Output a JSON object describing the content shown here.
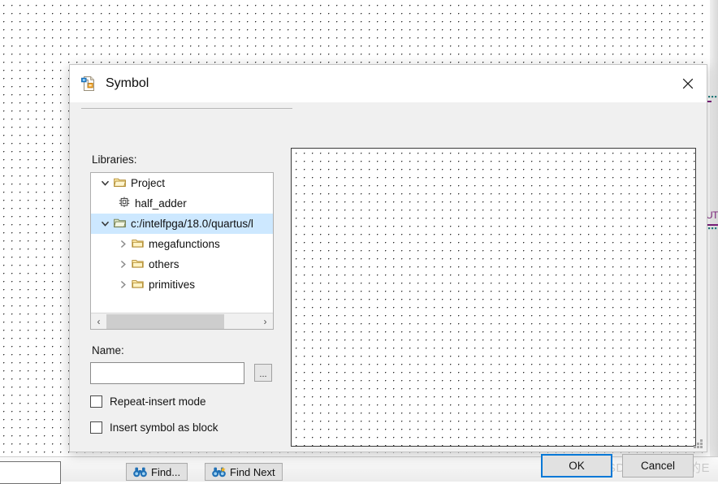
{
  "background": {
    "canvas_name": "schematic-grid-canvas",
    "schematic_fragment_label": "OUT",
    "grid_color": "#2b2b2b",
    "wire_color": "#7b1f7b"
  },
  "dialog": {
    "title": "Symbol",
    "title_icon": "symbol-file-icon",
    "close_icon": "close-icon",
    "libraries_label": "Libraries:",
    "name_label": "Name:",
    "name_value": "",
    "name_placeholder": "",
    "browse_label": "...",
    "tree": [
      {
        "label": "Project",
        "icon": "folder-open-icon",
        "twisty": "chevron-down-icon",
        "indent": 0,
        "selected": false
      },
      {
        "label": "half_adder",
        "icon": "symbol-block-icon",
        "twisty": "",
        "indent": 1,
        "selected": false
      },
      {
        "label": "c:/intelfpga/18.0/quartus/l",
        "icon": "folder-open-icon",
        "twisty": "chevron-down-icon",
        "indent": 0,
        "selected": true
      },
      {
        "label": "megafunctions",
        "icon": "folder-closed-icon",
        "twisty": "chevron-right-icon",
        "indent": 1,
        "selected": false
      },
      {
        "label": "others",
        "icon": "folder-closed-icon",
        "twisty": "chevron-right-icon",
        "indent": 1,
        "selected": false
      },
      {
        "label": "primitives",
        "icon": "folder-closed-icon",
        "twisty": "chevron-right-icon",
        "indent": 1,
        "selected": false
      }
    ],
    "scrollbar": {
      "left_arrow": "‹",
      "right_arrow": "›"
    },
    "checkboxes": [
      {
        "label": "Repeat-insert mode",
        "checked": false
      },
      {
        "label": "Insert symbol as block",
        "checked": false
      }
    ],
    "buttons": {
      "ok": "OK",
      "cancel": "Cancel",
      "ok_focus_color": "#0078d7"
    },
    "preview_name": "symbol-preview-grid"
  },
  "bottom_bar": {
    "find_label": "Find...",
    "find_next_label": "Find Next",
    "find_icon": "binoculars-icon",
    "find_next_icon": "binoculars-next-icon",
    "search_field_value": ""
  },
  "watermark": {
    "text": "CSDN @意大利的E"
  }
}
